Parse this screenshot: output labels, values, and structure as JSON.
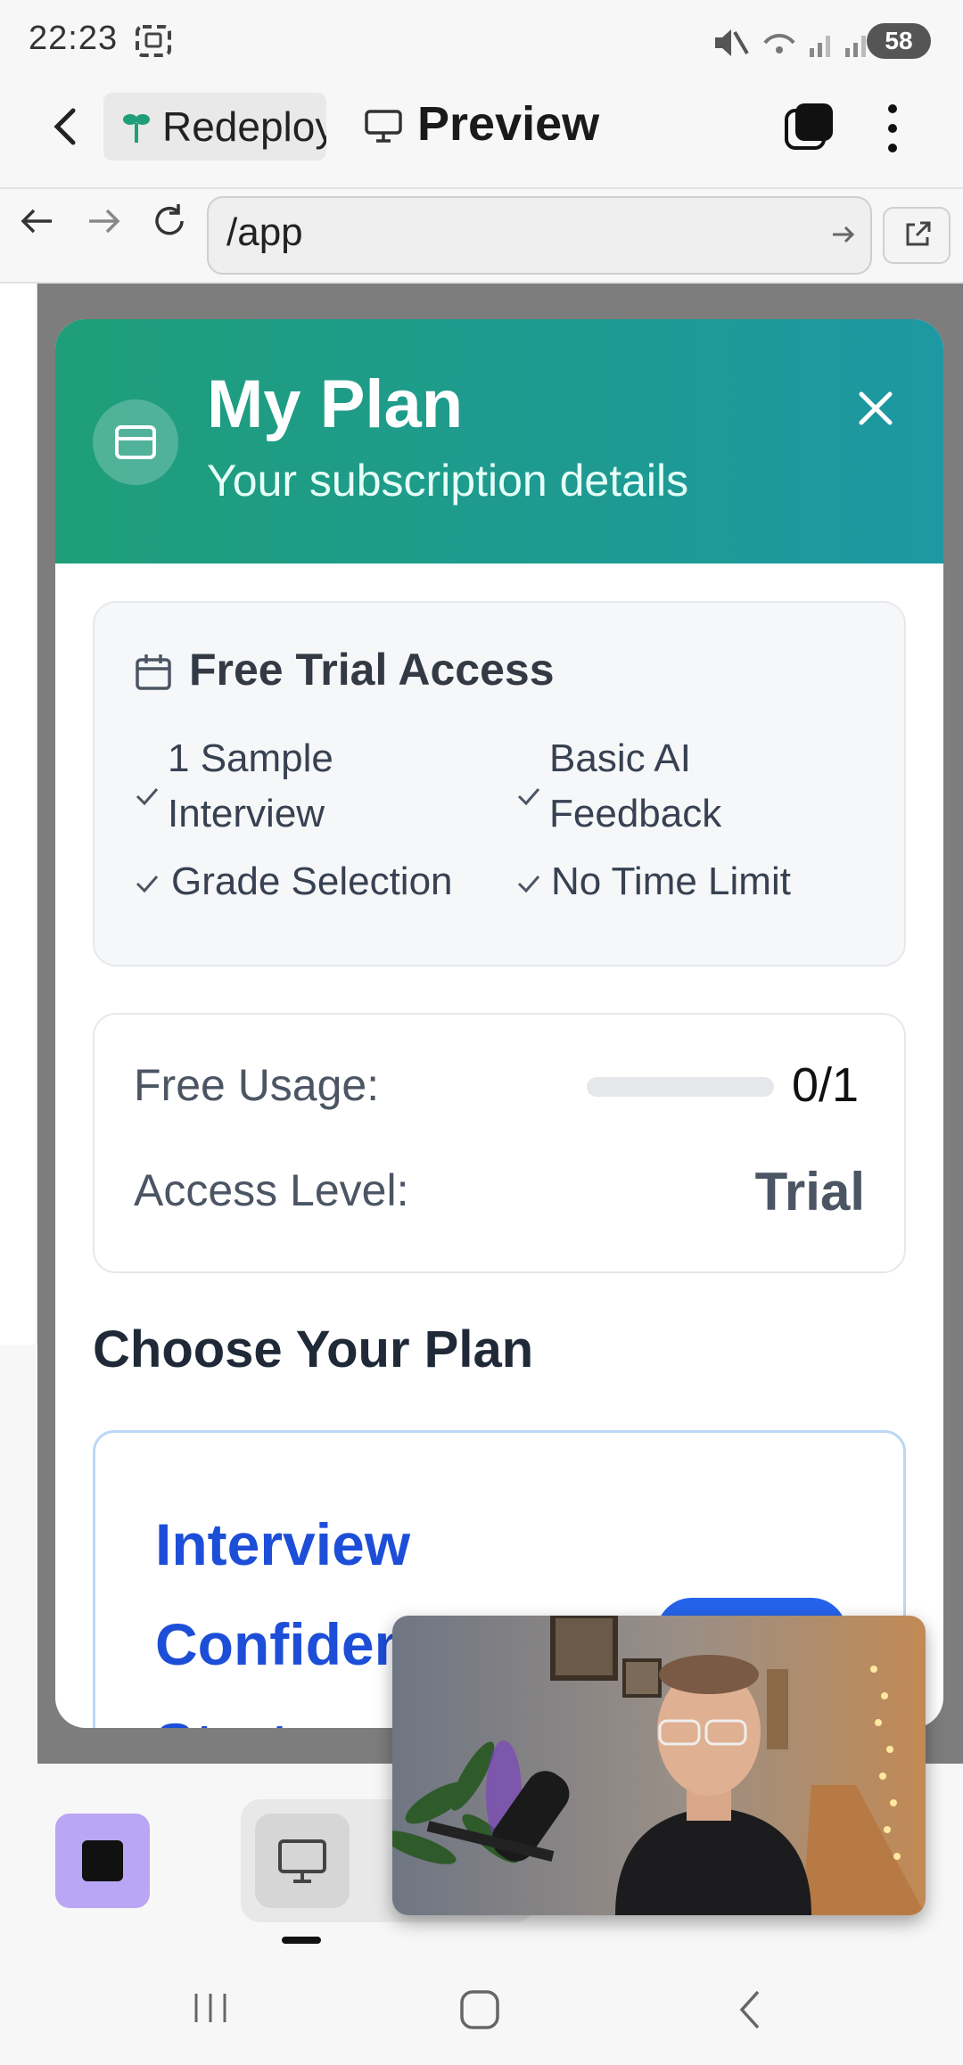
{
  "status_bar": {
    "time": "22:23",
    "battery": "58"
  },
  "app_bar": {
    "tab_label": "Redeploy",
    "title": "Preview"
  },
  "url_bar": {
    "url": "/app"
  },
  "modal": {
    "title": "My Plan",
    "subtitle": "Your subscription details",
    "trial": {
      "title": "Free Trial Access",
      "features": [
        "1 Sample Interview",
        "Basic AI Feedback",
        "Grade Selection",
        "No Time Limit"
      ]
    },
    "usage": {
      "label": "Free Usage:",
      "value": "0/1",
      "progress": 0
    },
    "access": {
      "label": "Access Level:",
      "value": "Trial"
    },
    "choose_heading": "Choose Your Plan",
    "plan": {
      "name": "Interview Confidence Starter"
    }
  },
  "colors": {
    "header_start": "#1f9e7a",
    "header_end": "#1e98a2",
    "plan_blue": "#1d4ed8",
    "stop_button": "#b9a6f5"
  },
  "icons": [
    "back-icon",
    "sprout-icon",
    "monitor-icon",
    "tabs-icon",
    "more-vert-icon",
    "nav-back-icon",
    "nav-forward-icon",
    "reload-icon",
    "go-arrow-icon",
    "open-external-icon",
    "credit-card-icon",
    "close-icon",
    "calendar-icon",
    "check-icon",
    "stop-icon",
    "desktop-icon",
    "recents-icon",
    "home-icon",
    "system-back-icon"
  ]
}
